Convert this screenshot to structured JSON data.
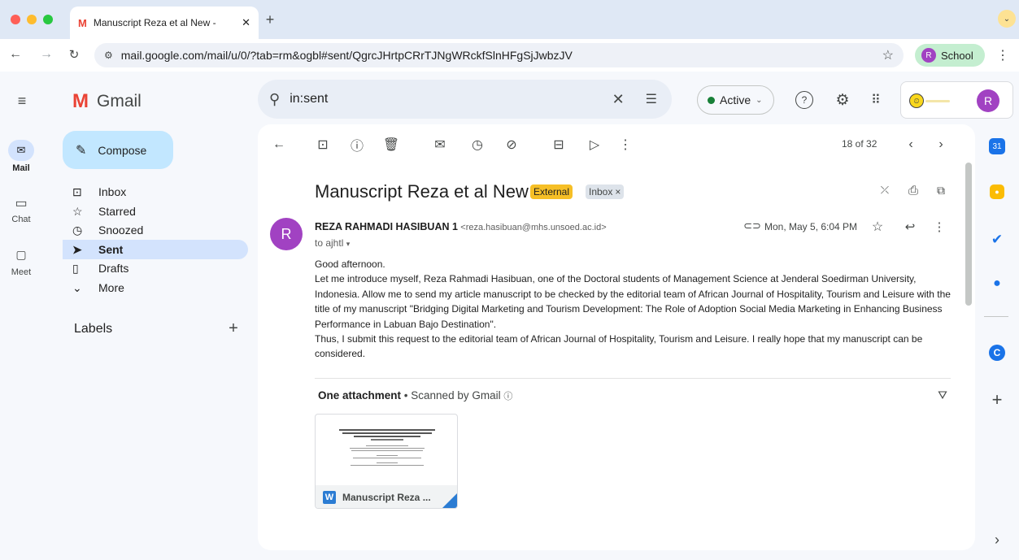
{
  "browser": {
    "tab_title": "Manuscript Reza et al New - ",
    "url": "mail.google.com/mail/u/0/?tab=rm&ogbl#sent/QgrcJHrtpCRrTJNgWRckfSlnHFgSjJwbzJV",
    "profile_label": "School",
    "profile_initial": "R"
  },
  "rail": {
    "mail": "Mail",
    "chat": "Chat",
    "meet": "Meet"
  },
  "app": {
    "brand": "Gmail",
    "compose": "Compose",
    "nav": {
      "inbox": "Inbox",
      "starred": "Starred",
      "snoozed": "Snoozed",
      "sent": "Sent",
      "drafts": "Drafts",
      "more": "More"
    },
    "labels_heading": "Labels",
    "search_value": "in:sent",
    "status": "Active",
    "account_initial": "R"
  },
  "email": {
    "pagination": "18 of 32",
    "subject": "Manuscript Reza et al New",
    "badge_external": "External",
    "badge_inbox": "Inbox",
    "sender_initial": "R",
    "sender_name": "REZA RAHMADI HASIBUAN 1",
    "sender_email": "<reza.hasibuan@mhs.unsoed.ac.id>",
    "date": "Mon, May 5, 6:04 PM",
    "recipient": "to ajhtl",
    "body": [
      "Good afternoon.",
      "Let me introduce myself, Reza Rahmadi Hasibuan, one of the Doctoral students of Management Science at Jenderal Soedirman University, Indonesia. Allow me to send my article manuscript to be checked by the editorial team of African Journal of Hospitality, Tourism and Leisure with the title of my manuscript \"Bridging Digital Marketing and Tourism Development: The Role of Adoption Social Media Marketing in Enhancing Business Performance in Labuan Bajo Destination\".",
      "Thus, I submit this request to the editorial team of African Journal of Hospitality, Tourism and Leisure. I really hope that my manuscript can be considered."
    ],
    "attachments_title": "One attachment",
    "scanned": "Scanned by Gmail",
    "attachment_name": "Manuscript Reza ...",
    "attachment_type": "W"
  },
  "colors": {
    "accent": "#0b57d0",
    "external_badge": "#f6bf26",
    "avatar": "#a142c2",
    "active_dot": "#188038"
  }
}
